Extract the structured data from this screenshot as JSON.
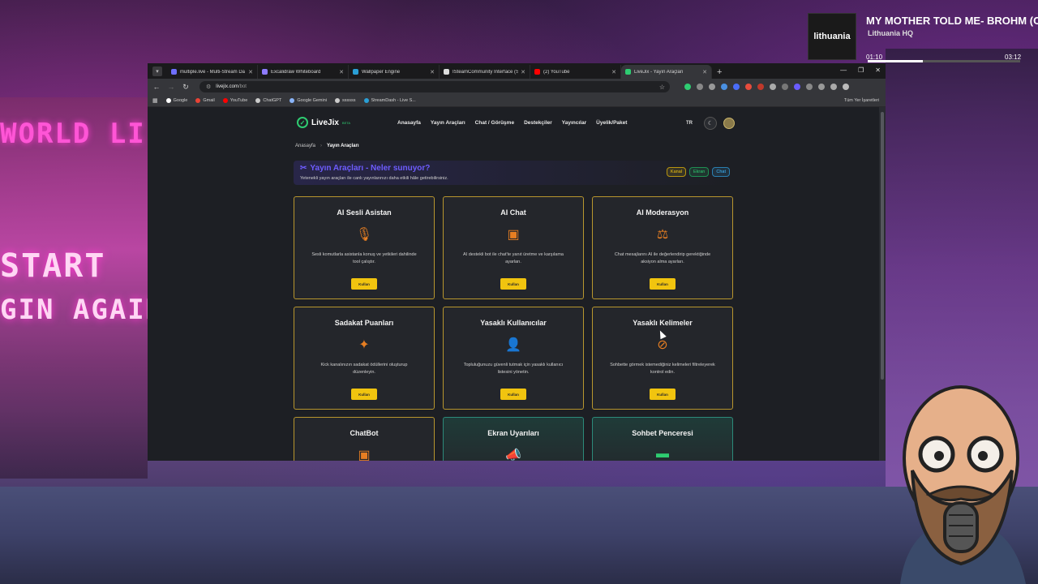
{
  "now_playing": {
    "title": "MY MOTHER TOLD ME- BROHM (C",
    "artist": "Lithuania HQ",
    "art_label": "lithuania",
    "time_elapsed": "01:10",
    "time_total": "03:12",
    "progress": 0.36
  },
  "background": {
    "sign_1": "WORLD LI",
    "sign_2": "START",
    "sign_3": "GIN AGAIN"
  },
  "browser": {
    "tabs": [
      {
        "label": "multiple.live - Multi-Stream Da",
        "color": "#6f6fff",
        "active": false
      },
      {
        "label": "Excalidraw Whiteboard",
        "color": "#8e7bff",
        "active": false
      },
      {
        "label": "Wallpaper Engine",
        "color": "#2a9fd6",
        "active": false
      },
      {
        "label": "ISteamCommunity Interface (S",
        "color": "#dddddd",
        "active": false
      },
      {
        "label": "(2) YouTube",
        "color": "#ff0000",
        "active": false
      },
      {
        "label": "LiveJix - Yayın Araçları",
        "color": "#2ecc71",
        "active": true
      }
    ],
    "new_tab": "+",
    "url_host": "livejix.com",
    "url_path": "/bot",
    "bookmarks": [
      {
        "label": "Google",
        "color": "#ffffff"
      },
      {
        "label": "Gmail",
        "color": "#ea4335"
      },
      {
        "label": "YouTube",
        "color": "#ff0000"
      },
      {
        "label": "ChatGPT",
        "color": "#cccccc"
      },
      {
        "label": "Google Gemini",
        "color": "#8ab4f8"
      },
      {
        "label": "ssssss",
        "color": "#cccccc"
      },
      {
        "label": "StreamDash - Live S...",
        "color": "#2a9fd6"
      }
    ],
    "bookmarks_right": "Tüm Yer İşaretleri"
  },
  "site": {
    "logo": "LiveJix",
    "logo_badge": "BETA",
    "nav": [
      "Anasayfa",
      "Yayın Araçları",
      "Chat / Görüşme",
      "Destekçiler",
      "Yayıncılar",
      "Üyelik/Paket"
    ],
    "lang": "TR",
    "breadcrumb": {
      "home": "Anasayfa",
      "current": "Yayın Araçları"
    },
    "hero_title": "Yayın Araçları - Neler sunuyor?",
    "hero_subtitle": "Yetenekli yayın araçları ile canlı yayınlarınızı daha etkili hâle getirebilirsiniz.",
    "badges": {
      "kanal": "Kanal",
      "ekran": "Ekran",
      "chat": "Chat"
    },
    "button_label": "Kullan",
    "cards": [
      {
        "title": "AI Sesli Asistan",
        "icon": "microphone-icon",
        "glyph": "🎙",
        "desc": "Sesli komutlarla asistanla konuş ve yetkileri dahilinde tool çalıştır."
      },
      {
        "title": "AI Chat",
        "icon": "chip-icon",
        "glyph": "▣",
        "desc": "AI destekli bot ile chat'te yanıt üretme ve karşılama ayarları."
      },
      {
        "title": "AI Moderasyon",
        "icon": "scales-icon",
        "glyph": "⚖",
        "desc": "Chat mesajlarını AI ile değerlendirip gerektiğinde aksiyon alma ayarları."
      },
      {
        "title": "Sadakat Puanları",
        "icon": "sparkles-icon",
        "glyph": "✦",
        "desc": "Kick kanalınızın sadakat ödüllerini oluşturup düzenleyin."
      },
      {
        "title": "Yasaklı Kullanıcılar",
        "icon": "user-ban-icon",
        "glyph": "👤",
        "desc": "Topluluğunuzu güvenli tutmak için yasaklı kullanıcı listesini yönetin."
      },
      {
        "title": "Yasaklı Kelimeler",
        "icon": "prohibited-icon",
        "glyph": "⊘",
        "desc": "Sohbette görmek istemediğiniz kelimeleri filtreleyerek kontrol edin."
      },
      {
        "title": "ChatBot",
        "icon": "bot-icon",
        "glyph": "▣",
        "desc": ""
      },
      {
        "title": "Ekran Uyarıları",
        "icon": "megaphone-icon",
        "glyph": "📣",
        "desc": ""
      },
      {
        "title": "Sohbet Penceresi",
        "icon": "chat-window-icon",
        "glyph": "▬",
        "desc": ""
      }
    ]
  }
}
